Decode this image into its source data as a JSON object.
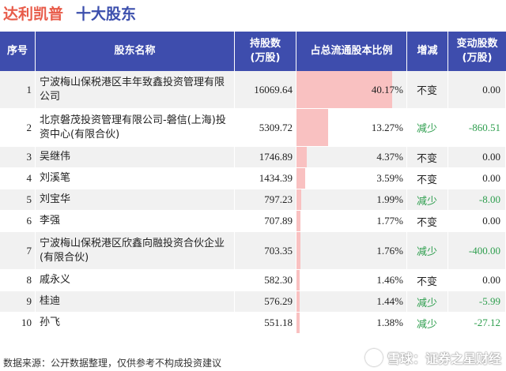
{
  "header": {
    "company": "达利凯普",
    "subtitle": "十大股东"
  },
  "columns": {
    "index": "序号",
    "name": "股东名称",
    "holding": "持股数\n(万股)",
    "ratio": "占总流通股本比例",
    "change": "增减",
    "change_amount": "变动股数\n(万股)"
  },
  "colors": {
    "header_bg": "#3e4dad",
    "ratio_bar": "#f9c1c1",
    "decrease": "#2e9e4e",
    "unchanged": "#222222"
  },
  "rows": [
    {
      "idx": "1",
      "name": "宁波梅山保税港区丰年致鑫投资管理有限公司",
      "holding": "16069.64",
      "ratio": "40.17%",
      "ratio_value": 40.17,
      "change": "不变",
      "change_amount": "0.00",
      "status": "unchanged"
    },
    {
      "idx": "2",
      "name": "北京磐茂投资管理有限公司-磐信(上海)投资中心(有限合伙)",
      "holding": "5309.72",
      "ratio": "13.27%",
      "ratio_value": 13.27,
      "change": "减少",
      "change_amount": "-860.51",
      "status": "decrease"
    },
    {
      "idx": "3",
      "name": "吴继伟",
      "holding": "1746.89",
      "ratio": "4.37%",
      "ratio_value": 4.37,
      "change": "不变",
      "change_amount": "0.00",
      "status": "unchanged"
    },
    {
      "idx": "4",
      "name": "刘溪笔",
      "holding": "1434.39",
      "ratio": "3.59%",
      "ratio_value": 3.59,
      "change": "不变",
      "change_amount": "0.00",
      "status": "unchanged"
    },
    {
      "idx": "5",
      "name": "刘宝华",
      "holding": "797.23",
      "ratio": "1.99%",
      "ratio_value": 1.99,
      "change": "减少",
      "change_amount": "-8.00",
      "status": "decrease"
    },
    {
      "idx": "6",
      "name": "李强",
      "holding": "707.89",
      "ratio": "1.77%",
      "ratio_value": 1.77,
      "change": "不变",
      "change_amount": "0.00",
      "status": "unchanged"
    },
    {
      "idx": "7",
      "name": "宁波梅山保税港区欣鑫向融投资合伙企业(有限合伙)",
      "holding": "703.35",
      "ratio": "1.76%",
      "ratio_value": 1.76,
      "change": "减少",
      "change_amount": "-400.00",
      "status": "decrease"
    },
    {
      "idx": "8",
      "name": "戚永义",
      "holding": "582.30",
      "ratio": "1.46%",
      "ratio_value": 1.46,
      "change": "不变",
      "change_amount": "0.00",
      "status": "unchanged"
    },
    {
      "idx": "9",
      "name": "桂迪",
      "holding": "576.29",
      "ratio": "1.44%",
      "ratio_value": 1.44,
      "change": "减少",
      "change_amount": "-5.99",
      "status": "decrease"
    },
    {
      "idx": "10",
      "name": "孙飞",
      "holding": "551.18",
      "ratio": "1.38%",
      "ratio_value": 1.38,
      "change": "减少",
      "change_amount": "-27.12",
      "status": "decrease"
    }
  ],
  "footer": {
    "source": "数据来源：公开数据整理，仅供参考不构成投资建议",
    "brand": "雪球：证券之星财经"
  }
}
